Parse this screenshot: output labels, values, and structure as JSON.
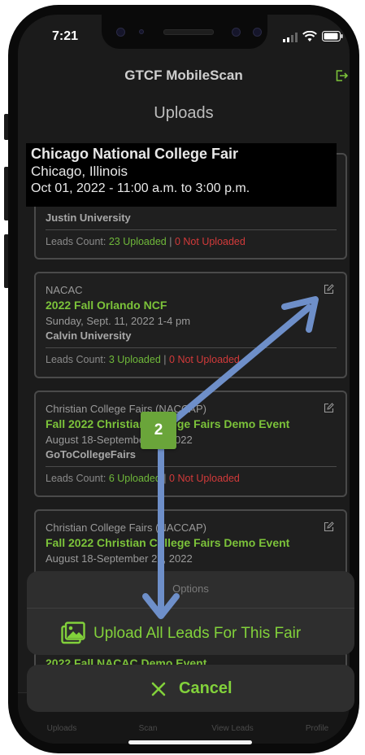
{
  "status_bar": {
    "time": "7:21"
  },
  "header": {
    "app_title": "GTCF MobileScan",
    "page_title": "Uploads"
  },
  "tooltip": {
    "fair_name": "Chicago National College Fair",
    "location": "Chicago, Illinois",
    "date_time": "Oct 01, 2022 - 11:00 a.m. to 3:00 p.m."
  },
  "cards": [
    {
      "org": "",
      "name": "",
      "date": "",
      "school": "Justin University",
      "uploaded": "23 Uploaded",
      "not_uploaded": "0 Not Uploaded"
    },
    {
      "org": "NACAC",
      "name": "2022 Fall Orlando NCF",
      "date": "Sunday, Sept. 11, 2022 1-4 pm",
      "school": "Calvin University",
      "uploaded": "3 Uploaded",
      "not_uploaded": "0 Not Uploaded"
    },
    {
      "org": "Christian College Fairs (NACCAP)",
      "name": "Fall 2022 Christian College Fairs Demo Event",
      "date": "August 18-September 27, 2022",
      "school": "GoToCollegeFairs",
      "uploaded": "6 Uploaded",
      "not_uploaded": "0 Not Uploaded"
    },
    {
      "org": "Christian College Fairs (NACCAP)",
      "name": "Fall 2022 Christian College Fairs Demo Event",
      "date": "August 18-September 27, 2022",
      "school": "",
      "uploaded": "",
      "not_uploaded": ""
    },
    {
      "name": "2022 Fall NACAC Demo Event"
    }
  ],
  "leads_label": "Leads Count:",
  "separator": "|",
  "sheet": {
    "header": "Options",
    "upload_label": "Upload All Leads For This Fair",
    "cancel_label": "Cancel"
  },
  "tabs": [
    "Uploads",
    "Scan",
    "View Leads",
    "Profile"
  ],
  "annotation": {
    "step": "2"
  },
  "colors": {
    "accent": "#82d13b",
    "uploaded": "#6fb83a",
    "not_uploaded": "#d23a3a",
    "arrow": "#6e8fc9"
  }
}
